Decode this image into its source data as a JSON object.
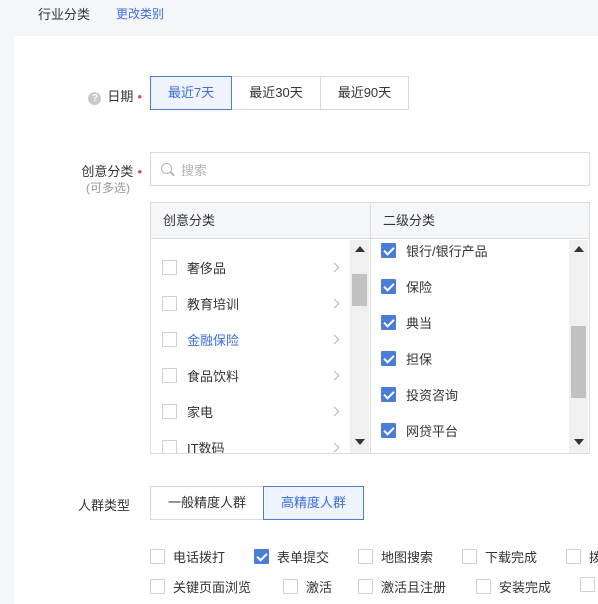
{
  "header": {
    "title": "行业分类",
    "change_link": "更改类别"
  },
  "date": {
    "label": "日期",
    "required_mark": "•",
    "options": [
      "最近7天",
      "最近30天",
      "最近90天"
    ],
    "selected": "最近7天"
  },
  "creative": {
    "label": "创意分类",
    "required_mark": "•",
    "sublabel": "(可多选)",
    "search_placeholder": "搜索",
    "col1_header": "创意分类",
    "col2_header": "二级分类",
    "col1_items": [
      {
        "label": "奢侈品",
        "checked": false,
        "highlight": false
      },
      {
        "label": "教育培训",
        "checked": false,
        "highlight": false
      },
      {
        "label": "金融保险",
        "checked": false,
        "highlight": true
      },
      {
        "label": "食品饮料",
        "checked": false,
        "highlight": false
      },
      {
        "label": "家电",
        "checked": false,
        "highlight": false
      },
      {
        "label": "IT数码",
        "checked": false,
        "highlight": false
      }
    ],
    "col2_items": [
      {
        "label": "银行/银行产品",
        "checked": true
      },
      {
        "label": "保险",
        "checked": true
      },
      {
        "label": "典当",
        "checked": true
      },
      {
        "label": "担保",
        "checked": true
      },
      {
        "label": "投资咨询",
        "checked": true
      },
      {
        "label": "网贷平台",
        "checked": true
      }
    ]
  },
  "crowd": {
    "label": "人群类型",
    "options": [
      "一般精度人群",
      "高精度人群"
    ],
    "selected": "高精度人群",
    "checkboxes": [
      {
        "label": "电话拨打",
        "checked": false
      },
      {
        "label": "表单提交",
        "checked": true
      },
      {
        "label": "地图搜索",
        "checked": false
      },
      {
        "label": "下载完成",
        "checked": false
      },
      {
        "label": "拨",
        "checked": false
      },
      {
        "label": "关键页面浏览",
        "checked": false
      },
      {
        "label": "激活",
        "checked": false
      },
      {
        "label": "激活且注册",
        "checked": false
      },
      {
        "label": "安装完成",
        "checked": false
      },
      {
        "label": "",
        "checked": false
      }
    ]
  },
  "colors": {
    "accent": "#3a6fd8",
    "checkbox_checked": "#4a7dd6",
    "required": "#e24a4a"
  }
}
